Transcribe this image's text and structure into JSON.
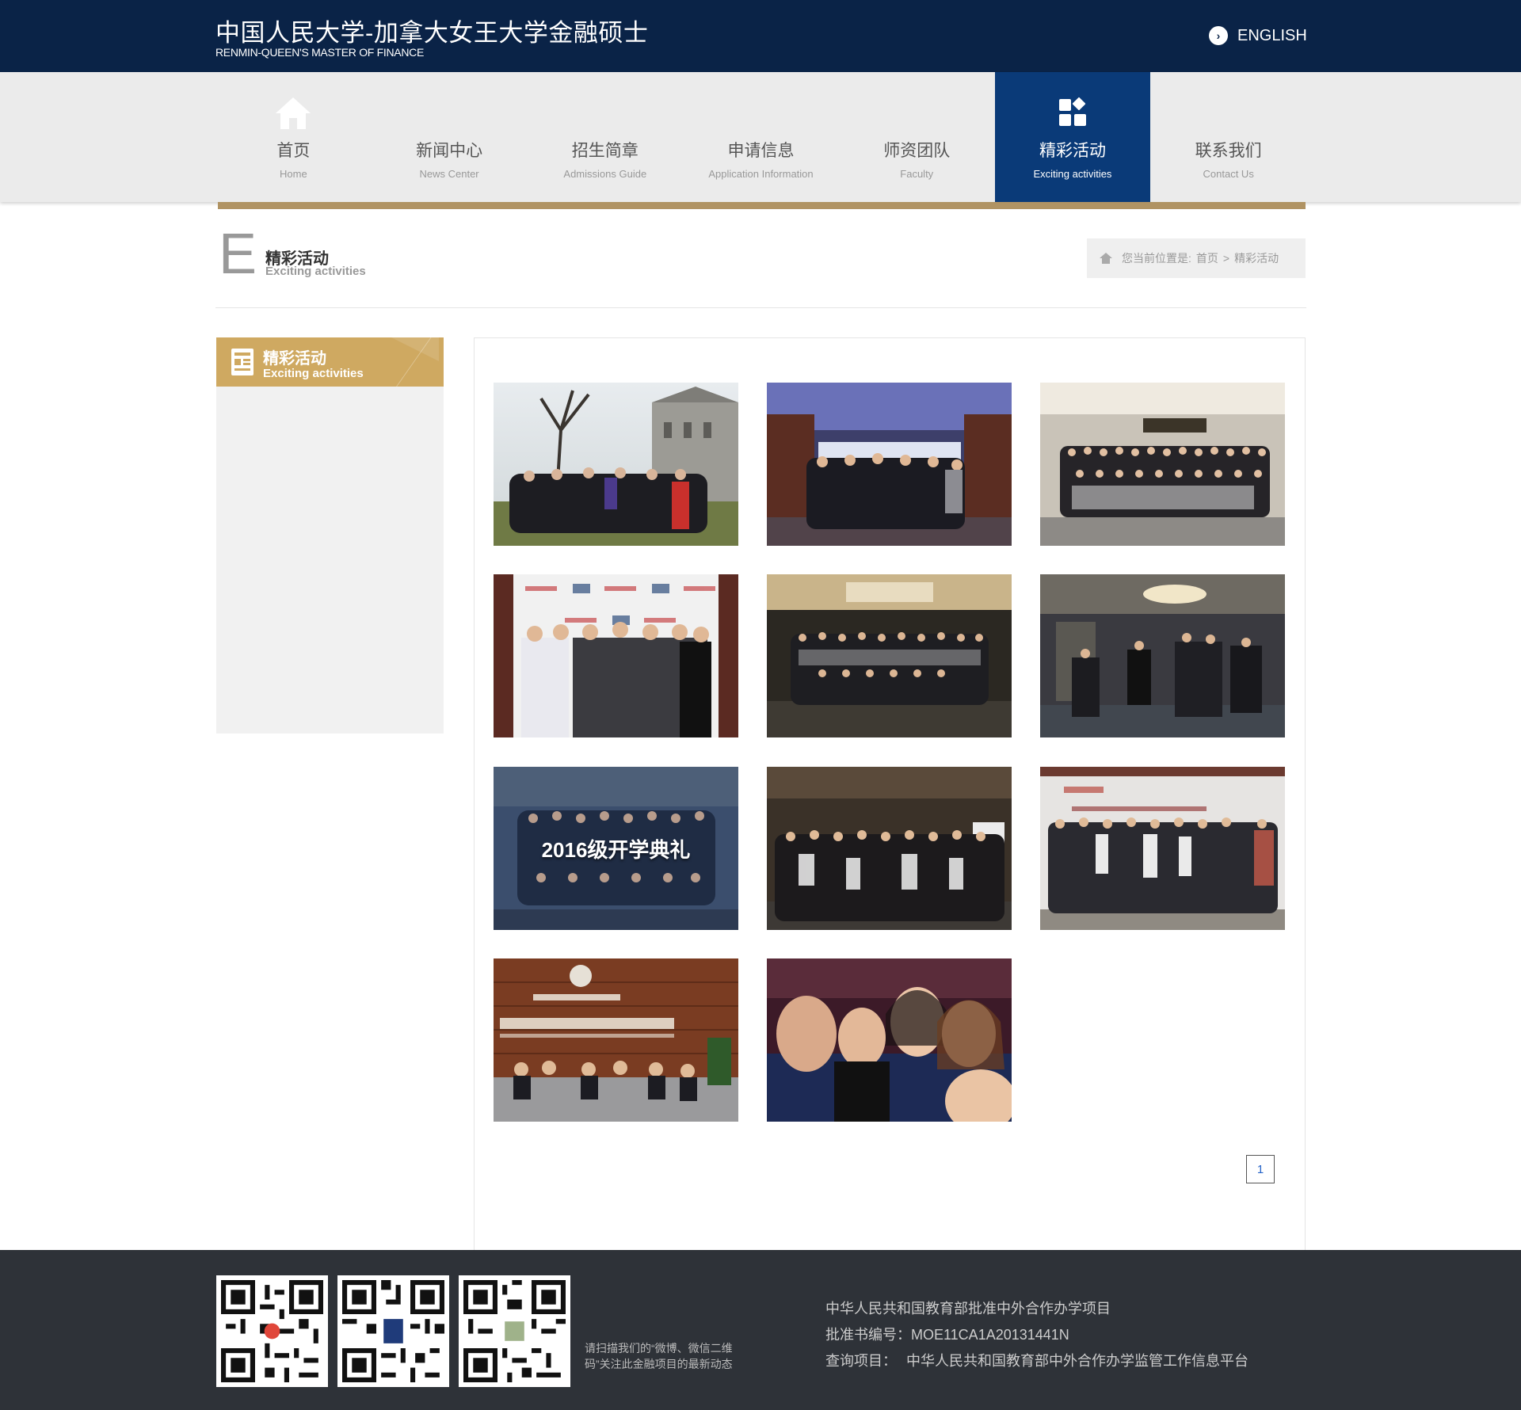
{
  "header": {
    "title": "中国人民大学-加拿大女王大学金融硕士",
    "subtitle": "RENMIN-QUEEN'S MASTER OF FINANCE",
    "language_switch": "ENGLISH"
  },
  "nav": {
    "items": [
      {
        "zh": "首页",
        "en": "Home"
      },
      {
        "zh": "新闻中心",
        "en": "News Center"
      },
      {
        "zh": "招生简章",
        "en": "Admissions Guide"
      },
      {
        "zh": "申请信息",
        "en": "Application Information"
      },
      {
        "zh": "师资团队",
        "en": "Faculty"
      },
      {
        "zh": "精彩活动",
        "en": "Exciting activities"
      },
      {
        "zh": "联系我们",
        "en": "Contact Us"
      }
    ],
    "active_index": 5
  },
  "page_heading": {
    "letter": "E",
    "title": "精彩活动",
    "subtitle": "Exciting activities"
  },
  "breadcrumb": {
    "prefix": "您当前位置是:",
    "home": "首页",
    "separator": ">",
    "current": "精彩活动"
  },
  "sidebar": {
    "title": "精彩活动",
    "subtitle": "Exciting activities"
  },
  "gallery": {
    "photo_overlay_text": "2016级开学典礼",
    "photo_count": 11
  },
  "pagination": {
    "current_page": "1"
  },
  "footer": {
    "qr_note": "请扫描我们的“微博、微信二维码”关注此金融项目的最新动态",
    "line1": "中华人民共和国教育部批准中外合作办学项目",
    "line2": "批准书编号：MOE11CA1A20131441N",
    "line3_label": "查询项目：",
    "line3_link": "中华人民共和国教育部中外合作办学监管工作信息平台"
  },
  "colors": {
    "header_bg": "#0a2347",
    "nav_active_bg": "#0a3a78",
    "gold_accent": "#b09363",
    "sidebar_head_bg": "#cfa961",
    "footer_bg": "#2e3238"
  }
}
